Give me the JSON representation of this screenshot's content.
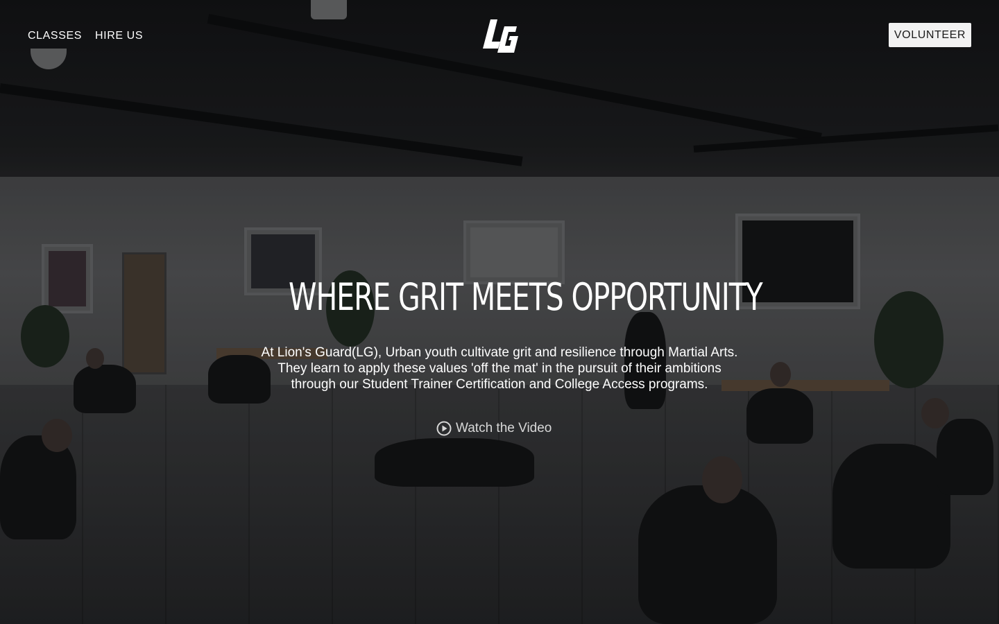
{
  "nav": {
    "links": [
      {
        "label": "CLASSES"
      },
      {
        "label": "HIRE US"
      }
    ],
    "logo_text": "LG",
    "volunteer_label": "VOLUNTEER"
  },
  "hero": {
    "headline": "WHERE GRIT MEETS OPPORTUNITY",
    "description": "At Lion's Guard(LG), Urban youth cultivate grit and resilience through Martial Arts. They learn to apply these values 'off the mat' in the pursuit of their ambitions through our Student Trainer Certification and College Access programs.",
    "watch_video_label": "Watch the Video",
    "watch_video_icon": "play-circle-icon"
  },
  "colors": {
    "text": "#ffffff",
    "button_bg": "#f2f2f2",
    "button_text": "#1a1a1a",
    "link_muted": "#d8d8d8"
  }
}
